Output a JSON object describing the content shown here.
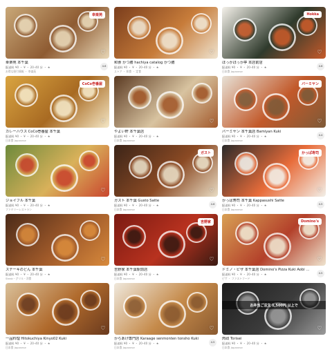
{
  "cards": [
    {
      "name": "幸楽苑 本千葉",
      "meta": "配送料 ¥0 ・ ¥ ・ 20–40 分 ・ ★",
      "promo": "お得な割引情報 ・ 幸楽苑",
      "rating": "4.6",
      "logo": "幸楽苑",
      "colors": [
        "#c9a878",
        "#8e5b32",
        "#e8d7b7"
      ]
    },
    {
      "name": "和食 かつ膳 hachiya catalog かつ膳",
      "meta": "配送料 ¥0 ・ ¥ ・ 20–40 分 ・ ★",
      "promo": "ストア ・ 和食 ・ 定食",
      "rating": "",
      "logo": "",
      "colors": [
        "#7a3d1c",
        "#c77c3a",
        "#efe3cf"
      ]
    },
    {
      "name": "ほっかほっか亭 本店前店",
      "meta": "配送料 ¥0 ・ ¥ ・ 20–40 分 ・ ★",
      "promo": "日本食 Japanese",
      "rating": "4.6",
      "logo": "Hokka",
      "colors": [
        "#f4f1ea",
        "#2f3a2c",
        "#c65a2a"
      ]
    },
    {
      "name": "カレーハウス CoCo壱番屋 本千葉",
      "meta": "配送料 ¥0 ・ ¥ ・ 20–40 分 ・ ★",
      "promo": "日本食 Japanese",
      "rating": "",
      "logo": "CoCo壱番屋",
      "colors": [
        "#d9a441",
        "#a86a22",
        "#f4e7c6"
      ]
    },
    {
      "name": "やよい軒 本千葉店",
      "meta": "配送料 ¥0 ・ ¥ ・ 20–40 分 ・ ★",
      "promo": "日本食 Japanese",
      "rating": "",
      "logo": "",
      "colors": [
        "#5b3a22",
        "#d8c3a0",
        "#a35a2c"
      ]
    },
    {
      "name": "バーミヤン 本千葉店 Bamiyan Kuki",
      "meta": "配送料 ¥0 ・ ¥ ・ 20–40 分 ・ ★",
      "promo": "日本食 Japanese",
      "rating": "4.4",
      "logo": "バーミヤン",
      "colors": [
        "#e7e1d6",
        "#c2592a",
        "#7e5a38"
      ]
    },
    {
      "name": "ジョイフル 本千葉",
      "meta": "配送料 ¥0 ・ ¥ ・ 20–40 分 ・ ★",
      "promo": "ファミリーレストラン",
      "rating": "",
      "logo": "",
      "colors": [
        "#6d8a3c",
        "#d9b15a",
        "#c9462e"
      ]
    },
    {
      "name": "ガスト 本千葉 Gusto Satte",
      "meta": "配送料 ¥0 ・ ¥ ・ 20–40 分 ・ ★",
      "promo": "日本食 Japanese",
      "rating": "4.6",
      "logo": "ガスト",
      "colors": [
        "#3b2418",
        "#8b4a24",
        "#e8dcc4"
      ]
    },
    {
      "name": "かっぱ寿司 本千葉 Kappasushi Satte",
      "meta": "配送料 ¥0 ・ ¥ ・ 20–40 分 ・ ★",
      "promo": "日本食 Japanese",
      "rating": "4.5",
      "logo": "かっぱ寿司",
      "colors": [
        "#2a2a2a",
        "#e86c3a",
        "#f2efe8"
      ]
    },
    {
      "name": "ステーキのどん 本千葉",
      "meta": "配送料 ¥0 ・ ¥ ・ 20–40 分 ・ ★",
      "promo": "Steak・グリル・洋食",
      "rating": "",
      "logo": "",
      "colors": [
        "#4a2a18",
        "#a05a2a",
        "#d88a3c"
      ]
    },
    {
      "name": "吉野家 本千葉駅前店",
      "meta": "配送料 ¥0 ・ ¥ ・ 20–40 分 ・ ★",
      "promo": "日本食 Japanese",
      "rating": "",
      "logo": "吉野家",
      "colors": [
        "#7a1a12",
        "#b8321f",
        "#3a1a12"
      ]
    },
    {
      "name": "ドミノ・ピザ 本千葉店 Domino's Pizza Kuki Aobi Store",
      "meta": "配送料 ¥0 ・ ¥ ・ 20–40 分 ・ ★",
      "promo": "ピザ ・ ファストフード",
      "rating": "4.5",
      "logo": "Domino's",
      "colors": [
        "#d8a055",
        "#b3402a",
        "#efe4cf"
      ]
    },
    {
      "name": "一品料理 Hitokuchiya Kinyo02 Kuki",
      "meta": "配送料 ¥0 ・ ¥ ・ 20–40 分 ・ ★",
      "promo": "日本食 Japanese",
      "rating": "",
      "logo": "",
      "colors": [
        "#d9c09a",
        "#b06a2c",
        "#6a3a1e"
      ]
    },
    {
      "name": "からあげ専門店 Karaage senmonten tonsho Kuki",
      "meta": "配送料 ¥0 ・ ¥ ・ 20–40 分 ・ ★",
      "promo": "日本食 Japanese",
      "rating": "4.5",
      "logo": "",
      "colors": [
        "#efe8dc",
        "#c58a4a",
        "#8a5a30"
      ]
    },
    {
      "name": "肉政 Torisei",
      "meta": "配送料 ¥0 ・ ¥ ・ 20–40 分 ・ ★",
      "promo": "日本食 Japanese",
      "rating": "",
      "logo": "お弁当ご注文 1,500円 以上で",
      "colors": [
        "#1e1e1e",
        "#3c3c3c",
        "#9a9a9a"
      ]
    }
  ]
}
